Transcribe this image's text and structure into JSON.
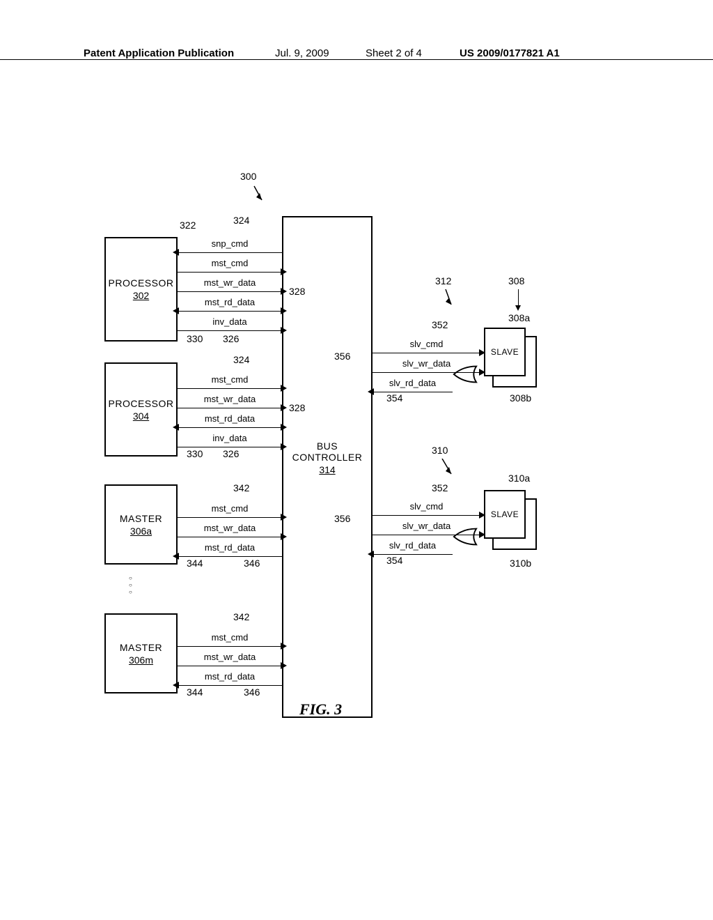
{
  "header": {
    "left": "Patent Application Publication",
    "date": "Jul. 9, 2009",
    "sheet": "Sheet 2 of 4",
    "pubno": "US 2009/0177821 A1"
  },
  "figure": {
    "ref_main": "300",
    "caption": "FIG. 3"
  },
  "blocks": {
    "proc1": {
      "title": "PROCESSOR",
      "ref": "302"
    },
    "proc2": {
      "title": "PROCESSOR",
      "ref": "304"
    },
    "master_a": {
      "title": "MASTER",
      "ref": "306a"
    },
    "master_m": {
      "title": "MASTER",
      "ref": "306m"
    },
    "buscon": {
      "title": "BUS CONTROLLER",
      "title_l1": "BUS",
      "title_l2": "CONTROLLER",
      "ref": "314"
    },
    "slave1": {
      "title": "SLAVE",
      "ref_group": "308",
      "ref_a": "308a",
      "ref_b": "308b",
      "ref_lead": "312"
    },
    "slave2": {
      "title": "SLAVE",
      "ref_group": "310",
      "ref_a": "310a",
      "ref_b": "310b"
    }
  },
  "signals": {
    "snp_cmd": "snp_cmd",
    "mst_cmd": "mst_cmd",
    "mst_wr_data": "mst_wr_data",
    "mst_rd_data": "mst_rd_data",
    "inv_data": "inv_data",
    "slv_cmd": "slv_cmd",
    "slv_wr_data": "slv_wr_data",
    "slv_rd_data": "slv_rd_data"
  },
  "annots": {
    "a322": "322",
    "a324": "324",
    "a326": "326",
    "a328": "328",
    "a330": "330",
    "a342": "342",
    "a344": "344",
    "a346": "346",
    "a352": "352",
    "a354": "354",
    "a356": "356"
  }
}
